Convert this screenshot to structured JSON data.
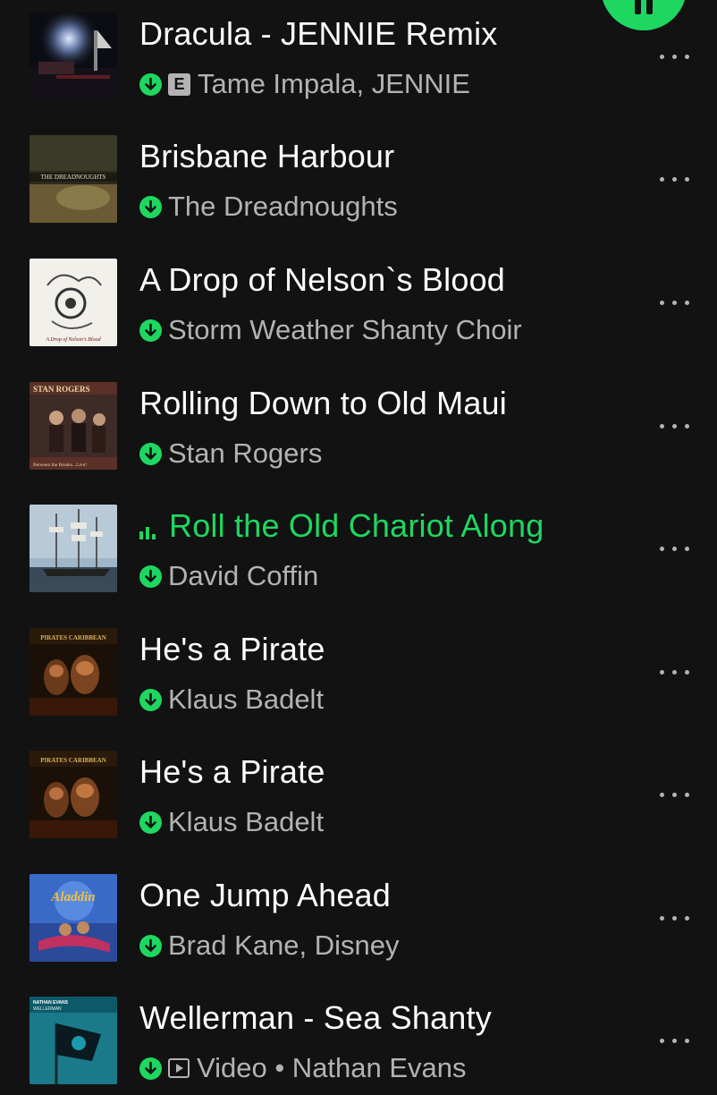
{
  "colors": {
    "background": "#121212",
    "accent": "#1ed760",
    "text_primary": "#ffffff",
    "text_secondary": "#b3b3b3"
  },
  "icons": {
    "download": "download-icon",
    "explicit": "explicit-badge",
    "now_playing": "equalizer-icon",
    "video": "video-icon",
    "more": "more-options-icon",
    "play": "play-pause-button"
  },
  "tracks": [
    {
      "title": "Dracula - JENNIE Remix",
      "artist": "Tame Impala, JENNIE",
      "explicit": true,
      "explicit_label": "E",
      "playing": false
    },
    {
      "title": "Brisbane Harbour",
      "artist": "The Dreadnoughts",
      "explicit": false,
      "playing": false,
      "art_text": "THE DREADNOUGHTS"
    },
    {
      "title": "A Drop of Nelson`s Blood",
      "artist": "Storm Weather Shanty Choir",
      "explicit": false,
      "playing": false,
      "art_text": "A Drop of Nelson's Blood"
    },
    {
      "title": "Rolling Down to Old Maui",
      "artist": "Stan Rogers",
      "explicit": false,
      "playing": false,
      "art_text": "STAN ROGERS",
      "art_text_2": "Between the Breaks...Live!"
    },
    {
      "title": "Roll the Old Chariot Along",
      "artist": "David Coffin",
      "explicit": false,
      "playing": true
    },
    {
      "title": "He's a Pirate",
      "artist": "Klaus Badelt",
      "explicit": false,
      "playing": false,
      "art_text": "PIRATES CARIBBEAN"
    },
    {
      "title": "He's a Pirate",
      "artist": "Klaus Badelt",
      "explicit": false,
      "playing": false,
      "art_text": "PIRATES CARIBBEAN"
    },
    {
      "title": "One Jump Ahead",
      "artist": "Brad Kane, Disney",
      "explicit": false,
      "playing": false,
      "art_text": "Aladdin"
    },
    {
      "title": "Wellerman - Sea Shanty",
      "artist": "Video • Nathan Evans",
      "explicit": false,
      "playing": false,
      "video": true,
      "art_text": "NATHAN EVANS",
      "art_text_2": "WELLERMAN"
    }
  ]
}
